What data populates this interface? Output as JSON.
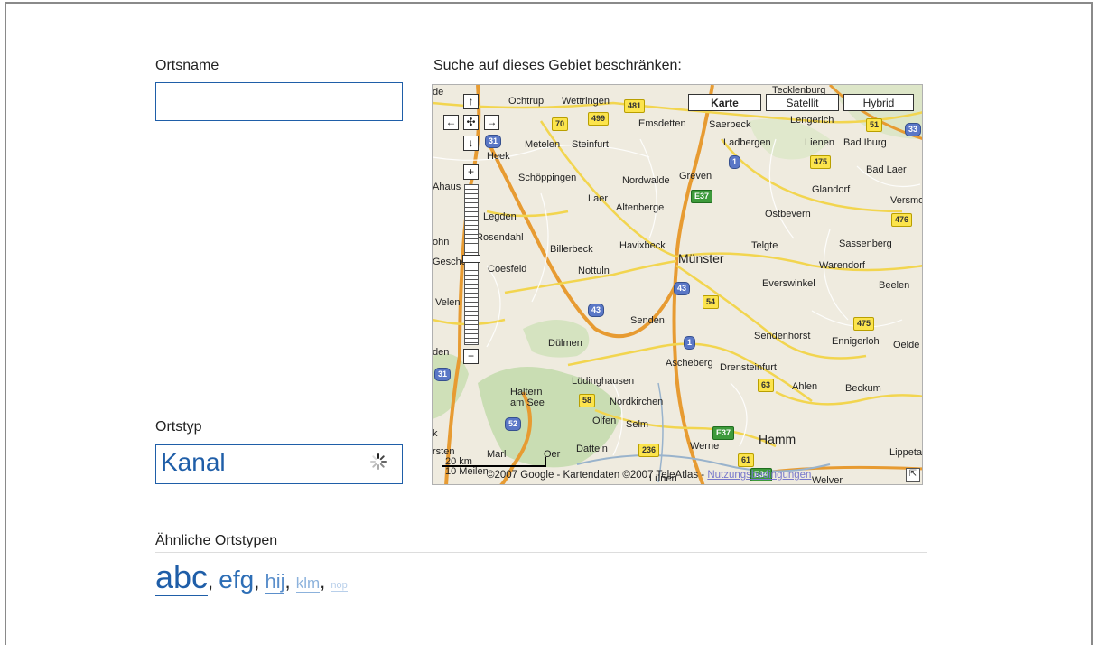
{
  "form": {
    "place_name_label": "Ortsname",
    "place_name_value": "",
    "area_label": "Suche auf dieses Gebiet beschränken:",
    "place_type_label": "Ortstyp",
    "place_type_value": "Kanal",
    "similar_label": "Ähnliche Ortstypen",
    "similar_tags": [
      {
        "label": "abc",
        "size": 36,
        "color": "#1f5ea8"
      },
      {
        "label": "efg",
        "size": 28,
        "color": "#2d6eb6"
      },
      {
        "label": "hij",
        "size": 22,
        "color": "#5b8fcb"
      },
      {
        "label": "klm",
        "size": 17,
        "color": "#8cb2dc"
      },
      {
        "label": "nop",
        "size": 11,
        "color": "#b8cfea"
      }
    ]
  },
  "map": {
    "type_buttons": [
      "Karte",
      "Satellit",
      "Hybrid"
    ],
    "selected_type": "Karte",
    "controls": {
      "pan_up": "↑",
      "pan_left": "←",
      "pan_center": "✣",
      "pan_right": "→",
      "pan_down": "↓",
      "zoom_in": "+",
      "zoom_out": "−"
    },
    "scale_km": "20 km",
    "scale_mi": "10 Meilen",
    "copyright": "©2007 Google - Kartendaten ©2007 TeleAtlas -",
    "terms_link": "Nutzungsbedingungen",
    "corner_icon": "⇱",
    "places": [
      "Ochtrup",
      "Wettringen",
      "Tecklenburg",
      "Emsdetten",
      "Saerbeck",
      "Lengerich",
      "Metelen",
      "Steinfurt",
      "Ladbergen",
      "Lienen",
      "Bad Iburg",
      "Heek",
      "Schöppingen",
      "Nordwalde",
      "Greven",
      "Glandorf",
      "Bad Laer",
      "Ahaus",
      "Laer",
      "Altenberge",
      "Ostbevern",
      "Versmold",
      "Legden",
      "Rosendahl",
      "Billerbeck",
      "Havixbeck",
      "Telgte",
      "Sassenberg",
      "Münster",
      "Warendorf",
      "Coesfeld",
      "Nottuln",
      "Everswinkel",
      "Beelen",
      "Velen",
      "Senden",
      "Sendenhorst",
      "Ennigerloh",
      "Oelde",
      "Dülmen",
      "Ascheberg",
      "Drensteinfurt",
      "Lüdinghausen",
      "Ahlen",
      "Beckum",
      "Haltern am See",
      "Nordkirchen",
      "Olfen",
      "Selm",
      "Hamm",
      "Marl",
      "Oer",
      "Datteln",
      "Werne",
      "Lippetal",
      "Lünen",
      "Welver",
      "Gescher",
      "de",
      "ohn",
      "den",
      "rsten",
      "k"
    ],
    "road_numbers": [
      "481",
      "499",
      "70",
      "51",
      "31",
      "33",
      "1",
      "475",
      "E37",
      "476",
      "54",
      "43",
      "475",
      "63",
      "58",
      "52",
      "236",
      "61",
      "E34",
      "31",
      "43",
      "1",
      "E37"
    ]
  }
}
